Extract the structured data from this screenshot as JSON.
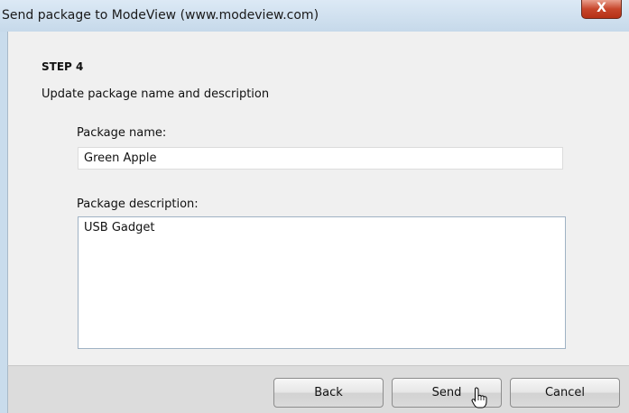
{
  "window": {
    "title": "Send package to ModeView (www.modeview.com)",
    "close_glyph": "X"
  },
  "step": {
    "title": "STEP 4",
    "subtitle": "Update package name and description"
  },
  "form": {
    "name_label": "Package name:",
    "name_value": "Green Apple",
    "description_label": "Package description:",
    "description_value": "USB Gadget"
  },
  "buttons": {
    "back": "Back",
    "send": "Send",
    "cancel": "Cancel"
  },
  "icons": {
    "close": "close-icon",
    "cursor": "hand-cursor-icon"
  }
}
